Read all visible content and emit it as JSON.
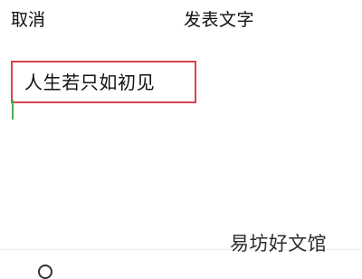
{
  "header": {
    "cancel_label": "取消",
    "title": "发表文字"
  },
  "editor": {
    "text": "人生若只如初见"
  },
  "watermark": {
    "text": "易坊好文馆"
  },
  "colors": {
    "highlight_border": "#d9434a",
    "caret": "#4caf50"
  },
  "icons": {
    "toolbar_first": "circle-icon"
  }
}
